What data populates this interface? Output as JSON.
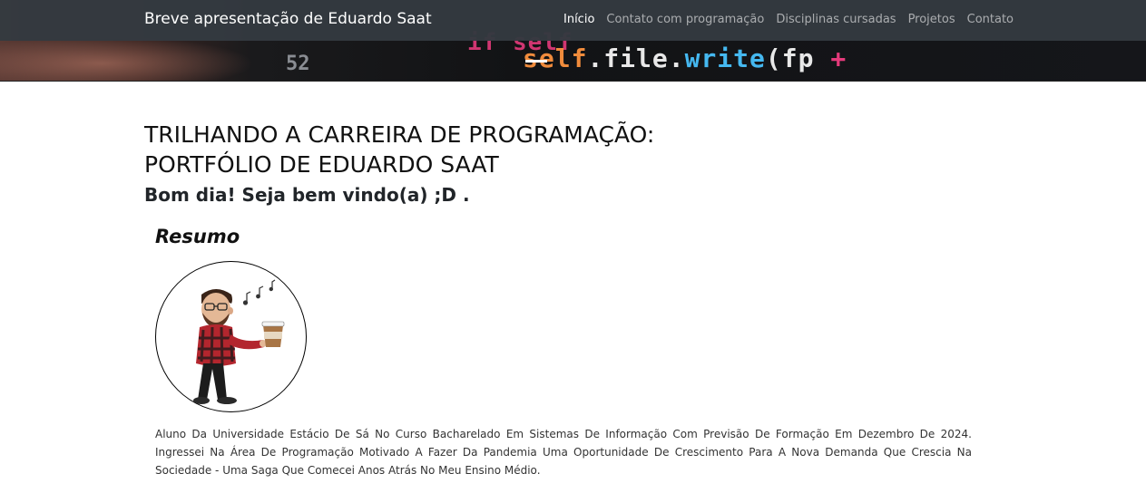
{
  "navbar": {
    "brand": "Breve apresentação de Eduardo Saat",
    "items": [
      {
        "label": "Início",
        "active": true
      },
      {
        "label": "Contato com programação",
        "active": false
      },
      {
        "label": "Disciplinas cursadas",
        "active": false
      },
      {
        "label": "Projetos",
        "active": false
      },
      {
        "label": "Contato",
        "active": false
      }
    ]
  },
  "hero": {
    "code_line1": "if self",
    "code_line2_a": "self",
    "code_line2_b": ".file.",
    "code_line2_c": "write",
    "code_line2_d": "(fp ",
    "code_line2_e": "+",
    "line_number": "52"
  },
  "main": {
    "title_line1": "TRILHANDO A CARREIRA DE PROGRAMAÇÃO:",
    "title_line2": "PORTFÓLIO DE EDUARDO SAAT",
    "greeting": "Bom dia! Seja bem vindo(a) ;D .",
    "section_title": "Resumo",
    "bio": "Aluno Da Universidade Estácio De Sá No Curso Bacharelado Em Sistemas De Informação Com Previsão De Formação Em Dezembro De 2024. Ingressei Na Área De Programação Motivado A Fazer Da Pandemia Uma Oportunidade De Crescimento Para A Nova Demanda Que Crescia Na Sociedade - Uma Saga Que Comecei Anos Atrás No Meu Ensino Médio."
  },
  "colors": {
    "navbar_bg": "#343a40",
    "nav_active": "#ffffff",
    "nav_inactive": "#9a9da0"
  }
}
